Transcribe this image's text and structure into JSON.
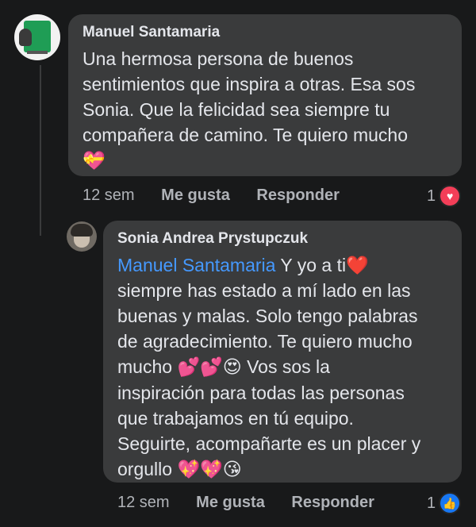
{
  "comments": [
    {
      "author": "Manuel Santamaria",
      "text_lines": [
        "Una hermosa persona de buenos",
        "sentimientos que inspira a otras. Esa sos",
        "Sonia.  Que la felicidad sea siempre tu",
        "compañera de camino. Te quiero mucho"
      ],
      "emoji_line": "💝",
      "time": "12 sem",
      "like_label": "Me gusta",
      "reply_label": "Responder",
      "reaction_count": "1",
      "reaction_icon": "heart-reaction-icon"
    },
    {
      "author": "Sonia Andrea Prystupczuk",
      "mention": "Manuel Santamaria",
      "first_line_rest": " Y yo a ti❤️",
      "text_lines": [
        "siempre has estado a mí lado en las",
        "buenas y malas. Solo tengo palabras",
        "de agradecimiento. Te quiero mucho"
      ],
      "line5_start": "mucho ",
      "line5_emojis": "💕💕😍",
      "line5_rest": " Vos sos la",
      "text_lines_2": [
        "inspiración para todas las personas",
        "que trabajamos en tú equipo.",
        "Seguirte, acompañarte es un placer y"
      ],
      "last_line_text": "orgullo ",
      "last_line_emojis": "💖💖😘",
      "time": "12 sem",
      "like_label": "Me gusta",
      "reply_label": "Responder",
      "reaction_count": "1",
      "reaction_icon": "like-reaction-icon"
    }
  ],
  "colors": {
    "background": "#18191a",
    "bubble": "#3a3b3c",
    "mention": "#4599ff",
    "love": "#f33e58",
    "like": "#1877f2"
  }
}
